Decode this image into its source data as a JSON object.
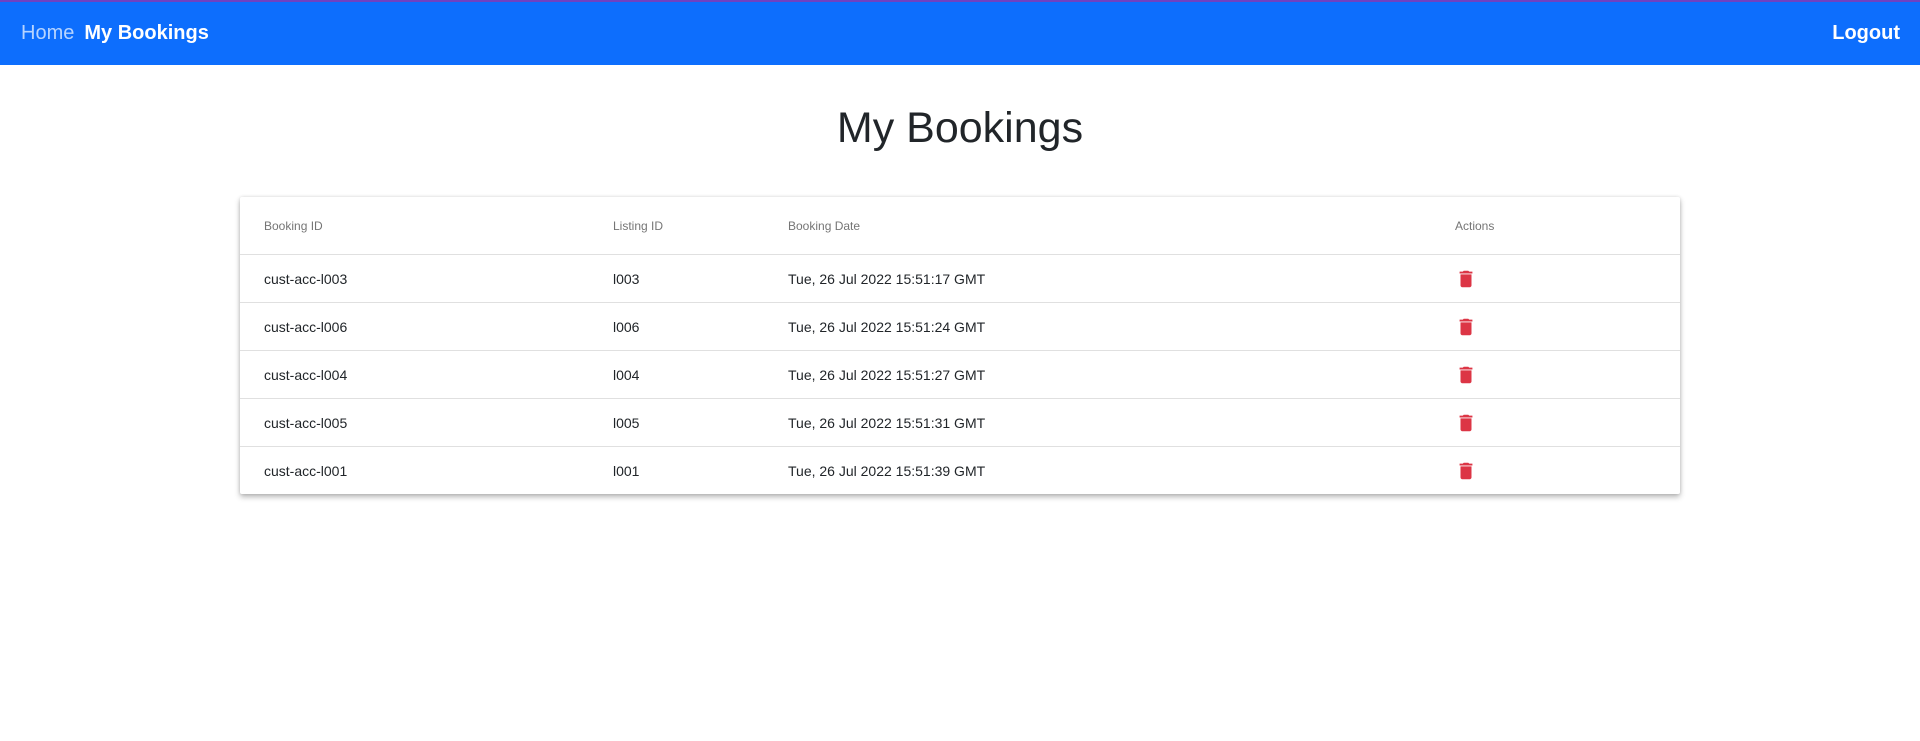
{
  "nav": {
    "home_label": "Home",
    "active_label": "My Bookings",
    "logout_label": "Logout"
  },
  "page": {
    "title": "My Bookings"
  },
  "colors": {
    "navbar": "#0d6efd",
    "delete_icon": "#dc3545"
  },
  "table": {
    "headers": [
      "Booking ID",
      "Listing ID",
      "Booking Date",
      "Actions"
    ],
    "rows": [
      {
        "booking_id": "cust-acc-l003",
        "listing_id": "l003",
        "booking_date": "Tue, 26 Jul 2022 15:51:17 GMT",
        "action_icon": "trash-icon"
      },
      {
        "booking_id": "cust-acc-l006",
        "listing_id": "l006",
        "booking_date": "Tue, 26 Jul 2022 15:51:24 GMT",
        "action_icon": "trash-icon"
      },
      {
        "booking_id": "cust-acc-l004",
        "listing_id": "l004",
        "booking_date": "Tue, 26 Jul 2022 15:51:27 GMT",
        "action_icon": "trash-icon"
      },
      {
        "booking_id": "cust-acc-l005",
        "listing_id": "l005",
        "booking_date": "Tue, 26 Jul 2022 15:51:31 GMT",
        "action_icon": "trash-icon"
      },
      {
        "booking_id": "cust-acc-l001",
        "listing_id": "l001",
        "booking_date": "Tue, 26 Jul 2022 15:51:39 GMT",
        "action_icon": "trash-icon"
      }
    ]
  }
}
